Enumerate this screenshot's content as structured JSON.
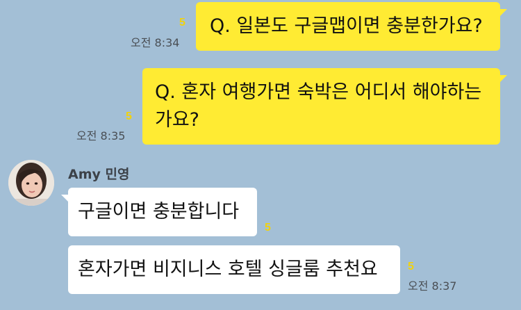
{
  "chat": {
    "messages": [
      {
        "side": "me",
        "text": "Q. 일본도 구글맵이면 충분한가요?",
        "unread": "5",
        "time": "오전 8:34"
      },
      {
        "side": "me",
        "text": "Q. 혼자 여행가면 숙박은 어디서 해야하는\n가요?",
        "unread": "5",
        "time": "오전 8:35"
      },
      {
        "side": "other",
        "sender": "Amy 민영",
        "text": "구글이면 충분합니다",
        "unread": "5",
        "time": ""
      },
      {
        "side": "other",
        "text": "혼자가면 비지니스 호텔 싱글룸 추천요",
        "unread": "5",
        "time": "오전 8:37"
      }
    ]
  },
  "colors": {
    "background": "#a3bfd6",
    "my_bubble": "#ffeb33",
    "other_bubble": "#ffffff",
    "unread": "#f1d20e",
    "time": "#4a4f55"
  },
  "icons": {
    "avatar": "profile-photo-icon"
  }
}
